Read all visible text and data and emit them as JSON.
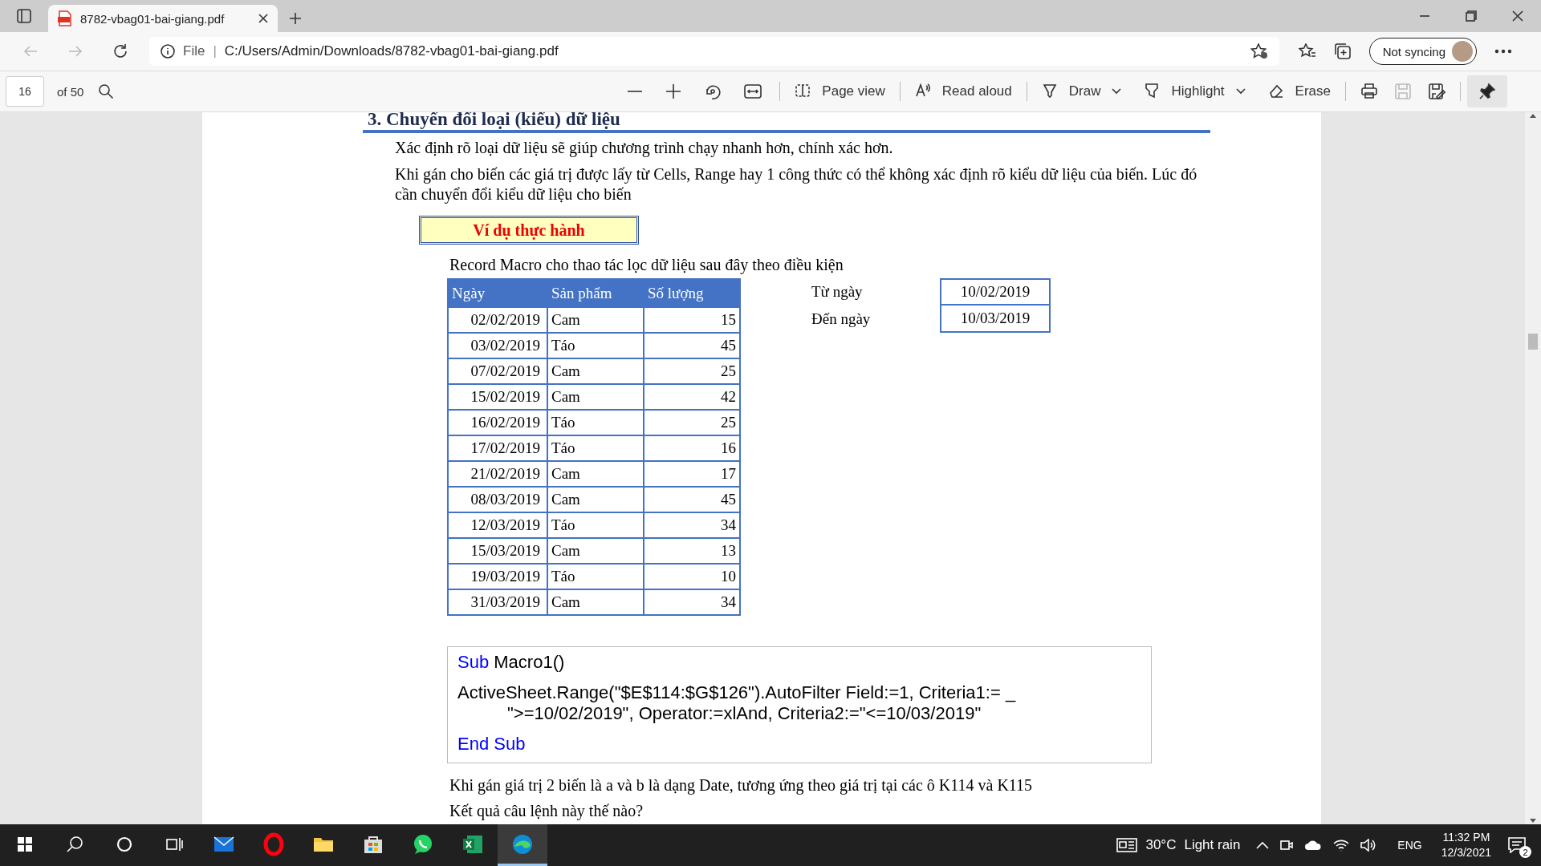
{
  "browser": {
    "tabs": [
      {
        "title": "8782-vbag01-bai-giang.pdf",
        "selected": true
      }
    ],
    "address": {
      "scheme": "File",
      "separator": "|",
      "url": "C:/Users/Admin/Downloads/8782-vbag01-bai-giang.pdf"
    },
    "sync_button": "Not syncing"
  },
  "pdf_toolbar": {
    "page": "16",
    "page_count": "of 50",
    "tools": [
      {
        "kind": "pageview",
        "label": "Page view",
        "disabled": false
      },
      {
        "kind": "read",
        "label": "Read aloud",
        "disabled": false
      },
      {
        "kind": "draw",
        "label": "Draw",
        "disabled": false
      },
      {
        "kind": "highlight",
        "label": "Highlight",
        "disabled": false
      },
      {
        "kind": "erase",
        "label": "Erase",
        "disabled": false
      },
      {
        "kind": "print",
        "disabled": false
      },
      {
        "kind": "save",
        "disabled": true
      },
      {
        "kind": "saveas",
        "disabled": false
      },
      {
        "kind": "pin",
        "disabled": false
      }
    ],
    "pinned": true
  },
  "document": {
    "heading": "3. Chuyển đổi loại (kiểu) dữ liệu",
    "paragraphs": [
      "Xác định rõ loại dữ liệu sẽ giúp chương trình chạy nhanh hơn, chính xác hơn.",
      "Khi gán cho biến các giá trị được lấy từ Cells, Range hay 1 công thức có thể không xác định rõ kiểu dữ liệu của biến. Lúc đó cần chuyển đổi kiểu dữ liệu cho biến"
    ],
    "example_label": "Ví dụ thực hành",
    "intro": "Record Macro cho thao tác lọc dữ liệu sau đây theo điều kiện",
    "table": {
      "columns": [
        "Ngày",
        "Sản phẩm",
        "Số lượng"
      ],
      "rows": [
        [
          "02/02/2019",
          "Cam",
          "15"
        ],
        [
          "03/02/2019",
          "Táo",
          "45"
        ],
        [
          "07/02/2019",
          "Cam",
          "25"
        ],
        [
          "15/02/2019",
          "Cam",
          "42"
        ],
        [
          "16/02/2019",
          "Táo",
          "25"
        ],
        [
          "17/02/2019",
          "Táo",
          "16"
        ],
        [
          "21/02/2019",
          "Cam",
          "17"
        ],
        [
          "08/03/2019",
          "Cam",
          "45"
        ],
        [
          "12/03/2019",
          "Táo",
          "34"
        ],
        [
          "15/03/2019",
          "Cam",
          "13"
        ],
        [
          "19/03/2019",
          "Táo",
          "10"
        ],
        [
          "31/03/2019",
          "Cam",
          "34"
        ]
      ]
    },
    "criteria": [
      {
        "label": "Từ ngày",
        "value": "10/02/2019"
      },
      {
        "label": "Đến ngày",
        "value": "10/03/2019"
      }
    ],
    "code": [
      {
        "indent": false,
        "segments": [
          {
            "text": "Sub",
            "keyword": true
          },
          {
            "text": " Macro1()",
            "keyword": false
          }
        ]
      },
      {
        "indent": false,
        "segments": [
          {
            "text": "ActiveSheet.Range(\"$E$114:$G$126\").AutoFilter Field:=1, Criteria1:= _",
            "keyword": false
          }
        ]
      },
      {
        "indent": true,
        "segments": [
          {
            "text": "\">=10/02/2019\", Operator:=xlAnd, Criteria2:=\"<=10/03/2019\"",
            "keyword": false
          }
        ]
      },
      {
        "indent": false,
        "segments": [
          {
            "text": "End Sub",
            "keyword": true
          }
        ]
      }
    ],
    "after": [
      "Khi gán giá trị 2 biến là a và b là dạng Date, tương ứng theo giá trị tại các ô K114 và K115",
      "Kết quả câu lệnh này thế nào?"
    ]
  },
  "taskbar": {
    "apps": [
      {
        "kind": "mail",
        "active": false
      },
      {
        "kind": "opera",
        "active": false
      },
      {
        "kind": "folder",
        "active": false
      },
      {
        "kind": "store",
        "active": false
      },
      {
        "kind": "whatsapp",
        "active": false
      },
      {
        "kind": "excel",
        "active": false
      },
      {
        "kind": "edge",
        "active": true
      }
    ],
    "weather": {
      "temperature": "30°C",
      "condition": "Light rain"
    },
    "language": "ENG",
    "time": "11:32 PM",
    "date": "12/3/2021",
    "notifications": "2"
  }
}
